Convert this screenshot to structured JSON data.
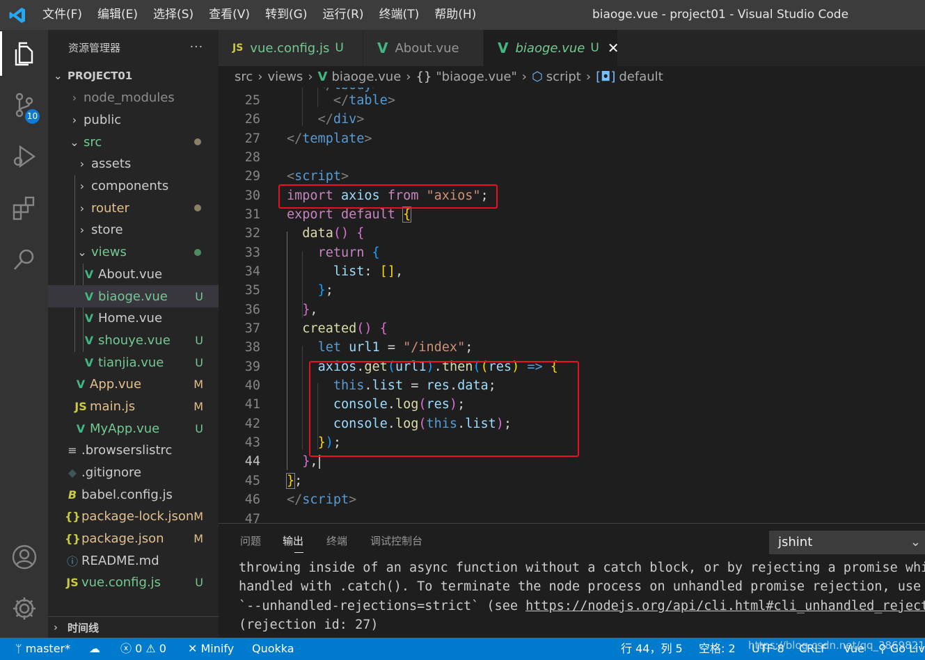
{
  "titlebar": {
    "menu": [
      "文件(F)",
      "编辑(E)",
      "选择(S)",
      "查看(V)",
      "转到(G)",
      "运行(R)",
      "终端(T)",
      "帮助(H)"
    ],
    "title": "biaoge.vue - project01 - Visual Studio Code"
  },
  "activity": {
    "scm_badge": "10"
  },
  "sidebar": {
    "header": "资源管理器",
    "more": "···",
    "project": "PROJECT01",
    "items": [
      {
        "label": "node_modules",
        "status": ""
      },
      {
        "label": "public",
        "status": ""
      },
      {
        "label": "src",
        "status": ""
      },
      {
        "label": "assets",
        "status": ""
      },
      {
        "label": "components",
        "status": ""
      },
      {
        "label": "router",
        "status": ""
      },
      {
        "label": "store",
        "status": ""
      },
      {
        "label": "views",
        "status": ""
      },
      {
        "label": "About.vue",
        "status": ""
      },
      {
        "label": "biaoge.vue",
        "status": "U"
      },
      {
        "label": "Home.vue",
        "status": ""
      },
      {
        "label": "shouye.vue",
        "status": "U"
      },
      {
        "label": "tianjia.vue",
        "status": "U"
      },
      {
        "label": "App.vue",
        "status": "M"
      },
      {
        "label": "main.js",
        "status": "M"
      },
      {
        "label": "MyApp.vue",
        "status": "U"
      },
      {
        "label": ".browserslistrc",
        "status": ""
      },
      {
        "label": ".gitignore",
        "status": ""
      },
      {
        "label": "babel.config.js",
        "status": ""
      },
      {
        "label": "package-lock.json",
        "status": "M"
      },
      {
        "label": "package.json",
        "status": "M"
      },
      {
        "label": "README.md",
        "status": ""
      },
      {
        "label": "vue.config.js",
        "status": "U"
      }
    ],
    "timeline": "时间线"
  },
  "tabs": [
    {
      "label": "vue.config.js",
      "status": "U"
    },
    {
      "label": "About.vue",
      "status": ""
    },
    {
      "label": "biaoge.vue",
      "status": "U"
    }
  ],
  "breadcrumb": {
    "p1": "src",
    "p2": "views",
    "p3": "biaoge.vue",
    "p4": "\"biaoge.vue\"",
    "p5": "script",
    "p6": "default"
  },
  "editor": {
    "line_numbers": [
      "25",
      "26",
      "27",
      "28",
      "29",
      "30",
      "31",
      "32",
      "33",
      "34",
      "35",
      "36",
      "37",
      "38",
      "39",
      "40",
      "41",
      "42",
      "43",
      "44",
      "45",
      "46",
      "47"
    ],
    "current_line": "44"
  },
  "panel": {
    "tabs": [
      "问题",
      "输出",
      "终端",
      "调试控制台"
    ],
    "channel": "jshint",
    "output": [
      "throwing inside of an async function without a catch block, or by rejecting a promise whi",
      "handled with .catch(). To terminate the node process on unhandled promise rejection, use ",
      "`--unhandled-rejections=strict` (see ",
      "(rejection id: 27)"
    ],
    "output_link": "https://nodejs.org/api/cli.html#cli_unhandled_reject"
  },
  "statusbar": {
    "branch": "master*",
    "errors": "0",
    "warnings": "0",
    "minify": "Minify",
    "quokka": "Quokka",
    "position": "行 44，列 5",
    "spaces": "空格: 2",
    "encoding": "UTF-8",
    "eol": "CRLF",
    "language": "Vue",
    "golive": "Go Live"
  },
  "watermark": "https://blog.csdn.net/qq_38698219",
  "colors": {
    "accent": "#007acc",
    "highlight_box": "#e81123",
    "untracked": "#73c991",
    "modified": "#e2c08d"
  }
}
